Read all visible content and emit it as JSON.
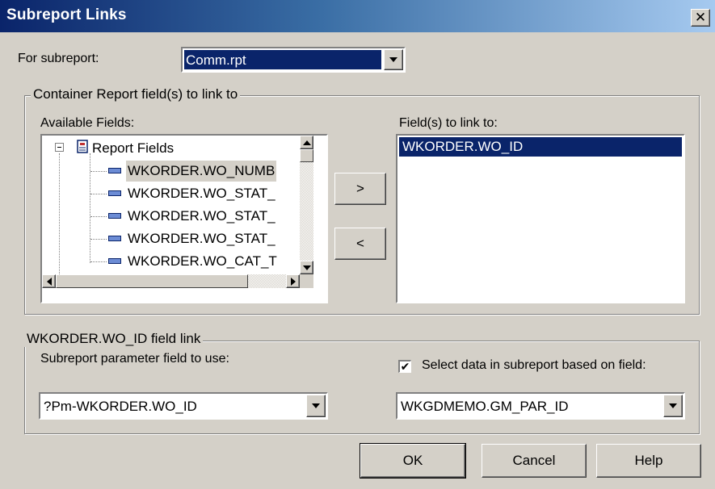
{
  "window": {
    "title": "Subreport Links",
    "close_glyph": "✕"
  },
  "subreport": {
    "label": "For subreport:",
    "selected": "Comm.rpt"
  },
  "container_group": {
    "legend": "Container Report field(s) to link to",
    "available_label": "Available Fields:",
    "tree_root": "Report Fields",
    "available_items": [
      "WKORDER.WO_NUMB",
      "WKORDER.WO_STAT_",
      "WKORDER.WO_STAT_",
      "WKORDER.WO_STAT_",
      "WKORDER.WO_CAT_T"
    ],
    "add_button": ">",
    "remove_button": "<",
    "linked_label": "Field(s) to link to:",
    "linked_items": [
      "WKORDER.WO_ID"
    ]
  },
  "link_group": {
    "legend": "WKORDER.WO_ID field link",
    "param_label": "Subreport parameter field to use:",
    "param_value": "?Pm-WKORDER.WO_ID",
    "select_checkbox_label": "Select data in subreport based on field:",
    "select_checked": true,
    "select_value": "WKGDMEMO.GM_PAR_ID"
  },
  "buttons": {
    "ok": "OK",
    "cancel": "Cancel",
    "help": "Help"
  },
  "colors": {
    "dialog_bg": "#d4d0c8",
    "selection": "#0a246a",
    "title_gradient_start": "#0a246a",
    "title_gradient_end": "#a6caf0"
  },
  "icons": {
    "report": "report-fields-icon",
    "field": "database-field-icon",
    "check": "checkmark-icon"
  }
}
